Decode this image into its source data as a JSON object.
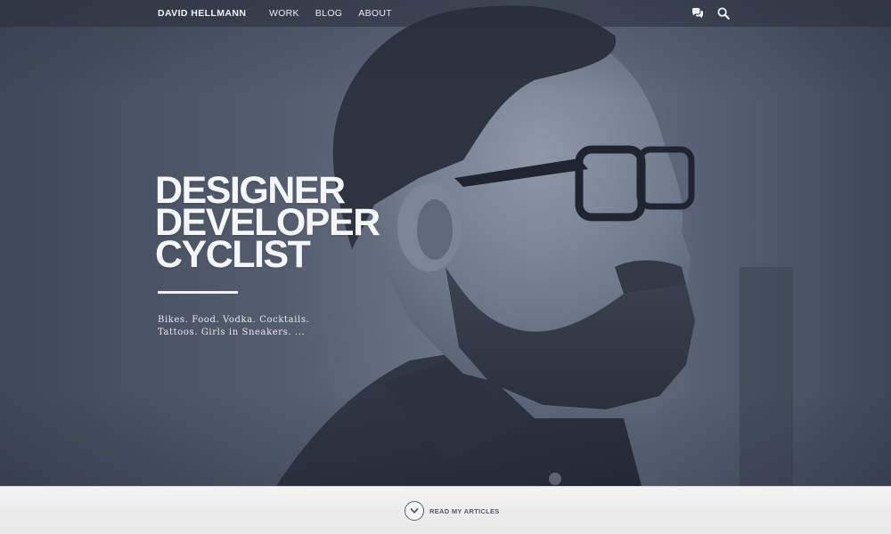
{
  "nav": {
    "brand": "DAVID HELLMANN",
    "items": [
      {
        "label": "WORK"
      },
      {
        "label": "BLOG"
      },
      {
        "label": "ABOUT"
      }
    ],
    "icons": [
      "chat-bubbles-icon",
      "search-icon"
    ]
  },
  "hero": {
    "headline": [
      "DESIGNER",
      "DEVELOPER",
      "CYCLIST"
    ],
    "tagline_lines": [
      "Bikes. Food. Vodka. Cocktails.",
      "Tattoos. Girls in Sneakers. ..."
    ]
  },
  "footer": {
    "cta_label": "READ MY ARTICLES",
    "cta_icon": "chevron-down-icon"
  },
  "colors": {
    "hero_overlay": "#4b5566",
    "text_light": "#f5f6f8",
    "bottom_bar": "#ececec",
    "accent_dark": "#4f5867"
  }
}
